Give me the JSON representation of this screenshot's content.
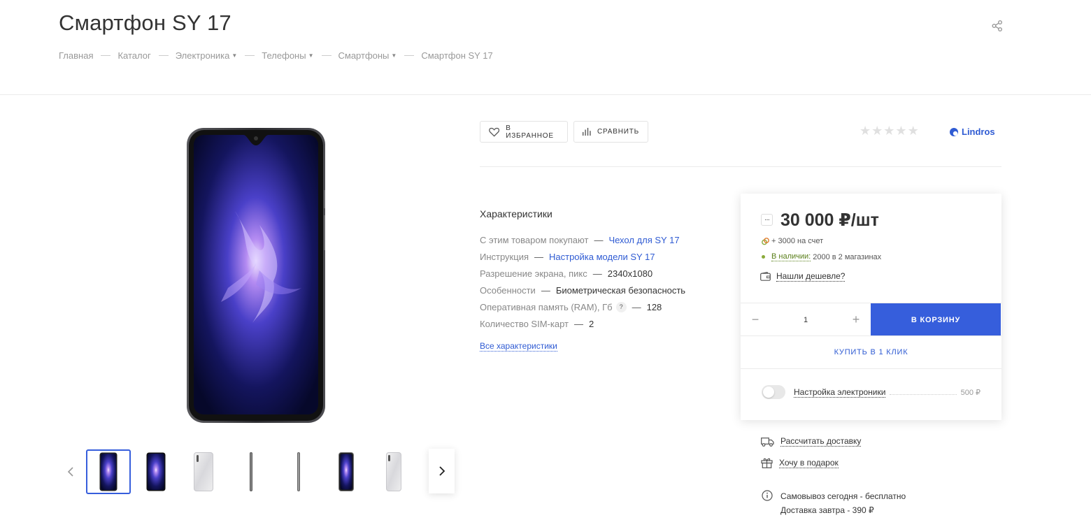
{
  "page": {
    "title": "Смартфон SY 17"
  },
  "breadcrumb": [
    {
      "label": "Главная",
      "dropdown": false
    },
    {
      "label": "Каталог",
      "dropdown": false
    },
    {
      "label": "Электроника",
      "dropdown": true
    },
    {
      "label": "Телефоны",
      "dropdown": true
    },
    {
      "label": "Смартфоны",
      "dropdown": true
    },
    {
      "label": "Смартфон SY 17",
      "dropdown": false
    }
  ],
  "icons": {
    "share": "share-icon",
    "favorite": "heart-icon",
    "compare": "bar-chart-icon",
    "price_more": "dots-icon",
    "bonus": "coins-icon",
    "cheaper": "wallet-icon",
    "delivery": "truck-icon",
    "gift": "gift-icon",
    "info": "info-icon"
  },
  "actions": {
    "favorite_label": "В ИЗБРАННОЕ",
    "compare_label": "СРАВНИТЬ"
  },
  "rating": {
    "value": 0,
    "max": 5
  },
  "brand": {
    "name": "Lindros",
    "color": "#2f5bd3"
  },
  "characteristics": {
    "title": "Характеристики",
    "items": [
      {
        "name": "С этим товаром покупают",
        "value": "Чехол для SY 17",
        "link": true
      },
      {
        "name": "Инструкция",
        "value": "Настройка модели SY 17",
        "link": true
      },
      {
        "name": "Разрешение экрана, пикс",
        "value": "2340x1080",
        "link": false
      },
      {
        "name": "Особенности",
        "value": "Биометрическая безопасность",
        "link": false
      },
      {
        "name": "Оперативная память (RAM), Гб",
        "value": "128",
        "link": false,
        "hint": "?"
      },
      {
        "name": "Количество SIM-карт",
        "value": "2",
        "link": false
      }
    ],
    "all_link": "Все характеристики"
  },
  "buy": {
    "price_icon_label": "···",
    "price": "30 000 ₽/шт",
    "bonus": "+ 3000 на счет",
    "stock_link": "В наличии:",
    "stock_text": "2000 в 2 магазинах",
    "cheaper": "Нашли дешевле?",
    "qty_minus": "−",
    "qty_value": "1",
    "qty_plus": "+",
    "to_cart": "В КОРЗИНУ",
    "one_click": "КУПИТЬ В 1 КЛИК",
    "service_name": "Настройка электроники",
    "service_price": "500 ₽",
    "service_enabled": false
  },
  "extras": {
    "delivery_calc": "Рассчитать доставку",
    "gift": "Хочу в подарок",
    "pickup_line1": "Самовывоз сегодня - бесплатно",
    "pickup_line2": "Доставка завтра - 390 ₽"
  },
  "gallery": {
    "selected_index": 0,
    "thumbs": [
      "front-dark",
      "front-dark",
      "back-silver",
      "side",
      "side",
      "front-dark",
      "back-silver"
    ]
  },
  "colors": {
    "accent": "#365edc",
    "link": "#2f5bd3",
    "in_stock": "#5a7f1a"
  }
}
